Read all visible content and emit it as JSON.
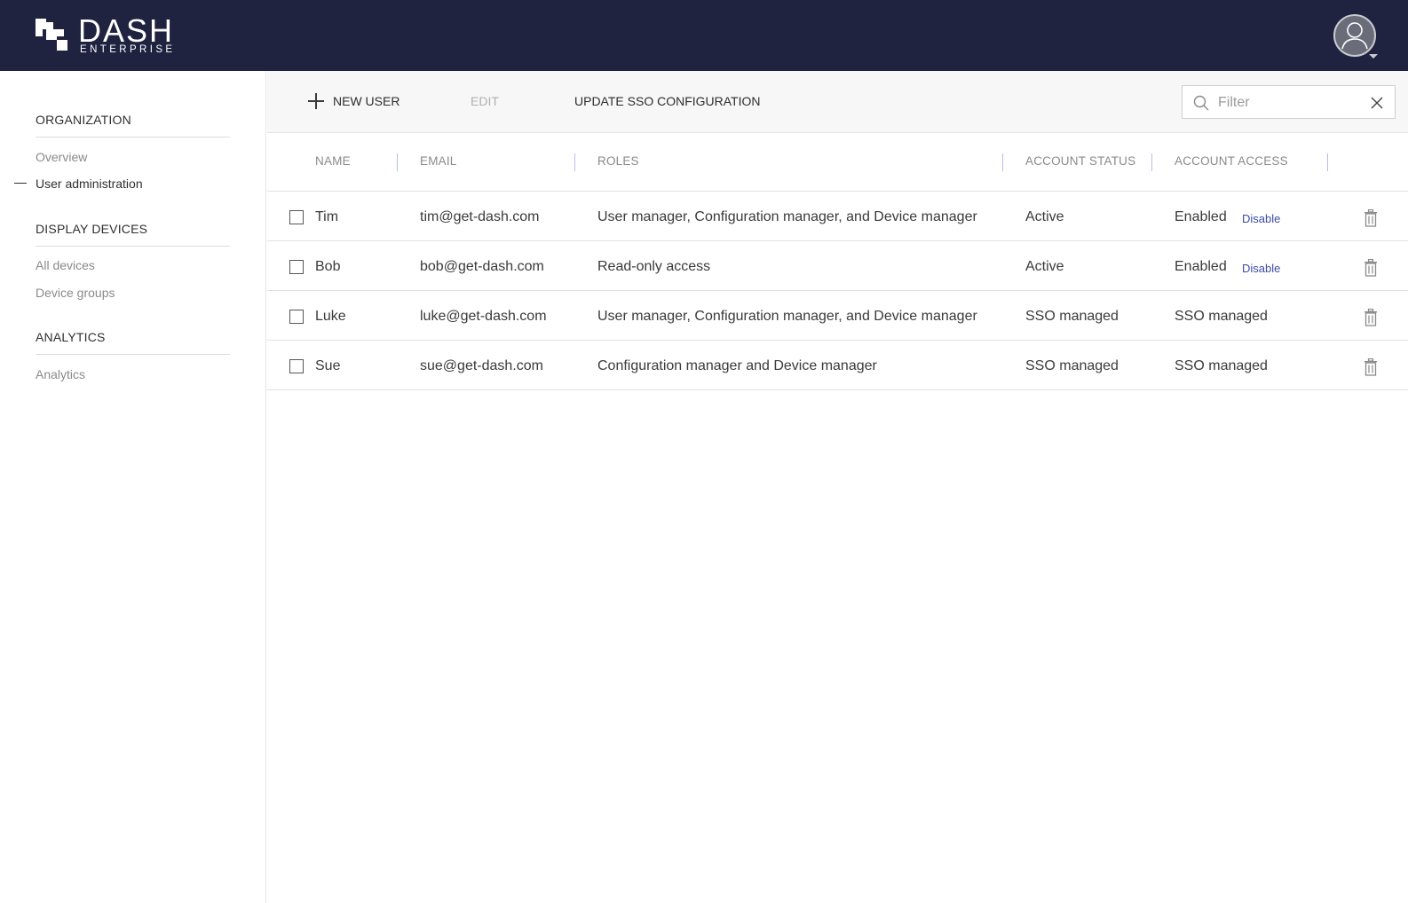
{
  "header": {
    "logo_text": "DASH",
    "logo_subtext": "ENTERPRISE"
  },
  "sidebar": {
    "sections": [
      {
        "title": "ORGANIZATION",
        "items": [
          {
            "label": "Overview",
            "active": false
          },
          {
            "label": "User administration",
            "active": true
          }
        ]
      },
      {
        "title": "DISPLAY DEVICES",
        "items": [
          {
            "label": "All devices",
            "active": false
          },
          {
            "label": "Device groups",
            "active": false
          }
        ]
      },
      {
        "title": "ANALYTICS",
        "items": [
          {
            "label": "Analytics",
            "active": false
          }
        ]
      }
    ]
  },
  "toolbar": {
    "new_user_label": "NEW USER",
    "edit_label": "EDIT",
    "update_sso_label": "UPDATE SSO CONFIGURATION",
    "filter_placeholder": "Filter"
  },
  "table": {
    "columns": [
      "NAME",
      "EMAIL",
      "ROLES",
      "ACCOUNT STATUS",
      "ACCOUNT ACCESS"
    ],
    "rows": [
      {
        "name": "Tim",
        "email": "tim@get-dash.com",
        "roles": "User manager, Configuration manager, and Device manager",
        "status": "Active",
        "access": "Enabled",
        "action": "Disable"
      },
      {
        "name": "Bob",
        "email": "bob@get-dash.com",
        "roles": "Read-only access",
        "status": "Active",
        "access": "Enabled",
        "action": "Disable"
      },
      {
        "name": "Luke",
        "email": "luke@get-dash.com",
        "roles": "User manager, Configuration manager, and Device manager",
        "status": "SSO managed",
        "access": "SSO managed",
        "action": ""
      },
      {
        "name": "Sue",
        "email": "sue@get-dash.com",
        "roles": "Configuration manager and Device manager",
        "status": "SSO managed",
        "access": "SSO managed",
        "action": ""
      }
    ]
  },
  "colors": {
    "header_bg": "#1f2340",
    "link": "#3b4aa8",
    "column_separator": "#b9bde4"
  }
}
